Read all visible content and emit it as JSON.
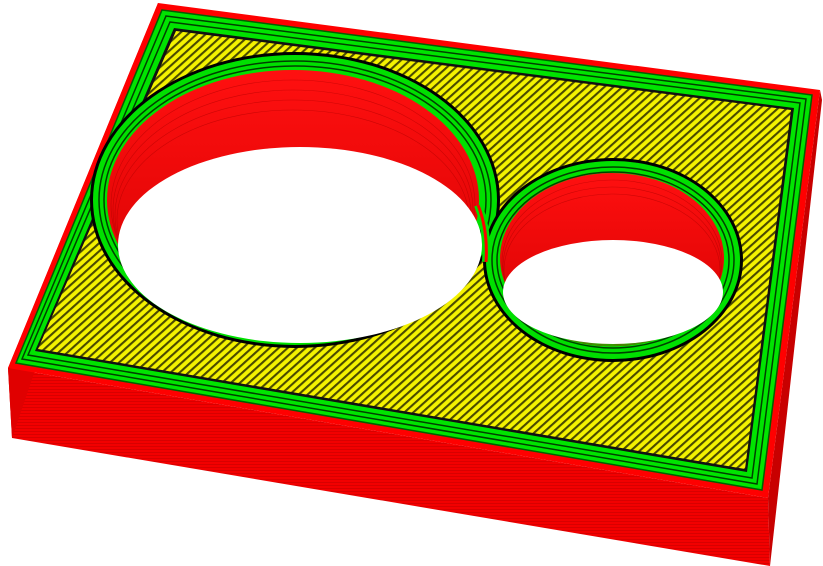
{
  "scene": {
    "subject": "sliced-plate-preview",
    "background_color": "#ffffff",
    "line_types": [
      {
        "name": "perimeter",
        "color": "#ff0000"
      },
      {
        "name": "external-perimeter",
        "color": "#00e000"
      },
      {
        "name": "solid-infill",
        "color": "#ffff00"
      },
      {
        "name": "extrusion-separator",
        "color": "#000000"
      }
    ],
    "holes": [
      {
        "name": "large-circular-hole"
      },
      {
        "name": "small-circular-hole"
      }
    ]
  }
}
